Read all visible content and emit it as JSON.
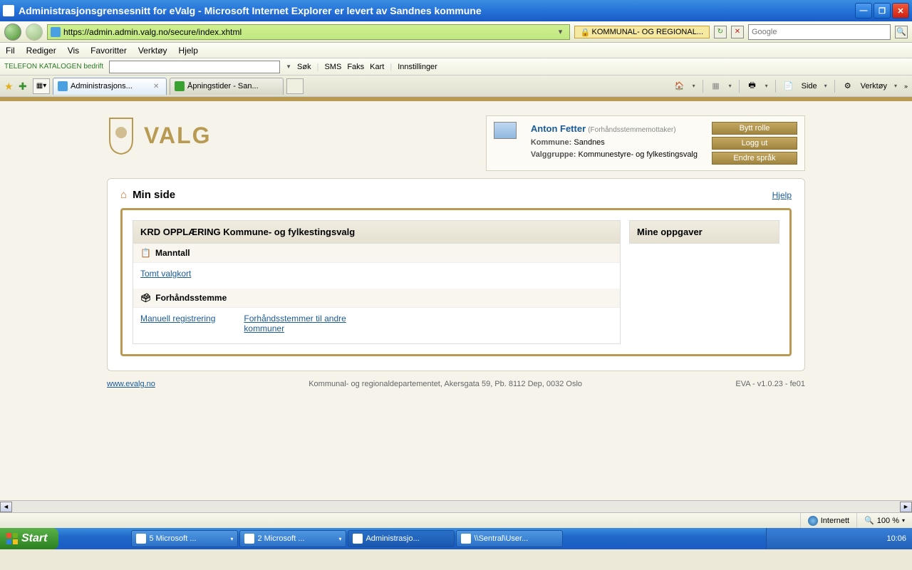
{
  "window": {
    "title": "Administrasjonsgrensesnitt for eValg - Microsoft Internet Explorer er levert av Sandnes kommune"
  },
  "nav": {
    "url": "https://admin.admin.valg.no/secure/index.xhtml",
    "security_label": "KOMMUNAL- OG REGIONAL...",
    "search_placeholder": "Google"
  },
  "menu": {
    "items": [
      "Fil",
      "Rediger",
      "Vis",
      "Favoritter",
      "Verktøy",
      "Hjelp"
    ]
  },
  "tel": {
    "brand": "TELEFON KATALOGEN bedrift",
    "links": [
      "Søk",
      "SMS",
      "Faks",
      "Kart",
      "Innstillinger"
    ]
  },
  "tabs": {
    "active": "Administrasjons...",
    "inactive": "Åpningstider - San..."
  },
  "toolbar": {
    "side": "Side",
    "verktoy": "Verktøy"
  },
  "app": {
    "logo": "VALG",
    "user": {
      "name": "Anton Fetter",
      "role": "(Forhåndsstemmemottaker)",
      "kommune_lbl": "Kommune:",
      "kommune": "Sandnes",
      "valggruppe_lbl": "Valggruppe:",
      "valggruppe": "Kommunestyre- og fylkestingsvalg"
    },
    "buttons": {
      "bytt": "Bytt rolle",
      "logg": "Logg ut",
      "sprak": "Endre språk"
    },
    "page_title": "Min side",
    "help": "Hjelp",
    "panel_title": "KRD OPPLÆRING Kommune- og fylkestingsvalg",
    "section1": {
      "title": "Manntall",
      "link1": "Tomt valgkort"
    },
    "section2": {
      "title": "Forhåndsstemme",
      "link1": "Manuell registrering",
      "link2": "Forhåndsstemmer til andre kommuner"
    },
    "side_panel": "Mine oppgaver",
    "footer": {
      "link": "www.evalg.no",
      "center": "Kommunal- og regionaldepartementet, Akersgata 59, Pb. 8112 Dep, 0032 Oslo",
      "version": "EVA - v1.0.23 - fe01"
    }
  },
  "status": {
    "zone": "Internett",
    "zoom": "100 %"
  },
  "taskbar": {
    "start": "Start",
    "items": [
      "5 Microsoft ...",
      "2 Microsoft ...",
      "Administrasjo...",
      "\\\\Sentral\\User..."
    ],
    "clock": "10:06"
  }
}
